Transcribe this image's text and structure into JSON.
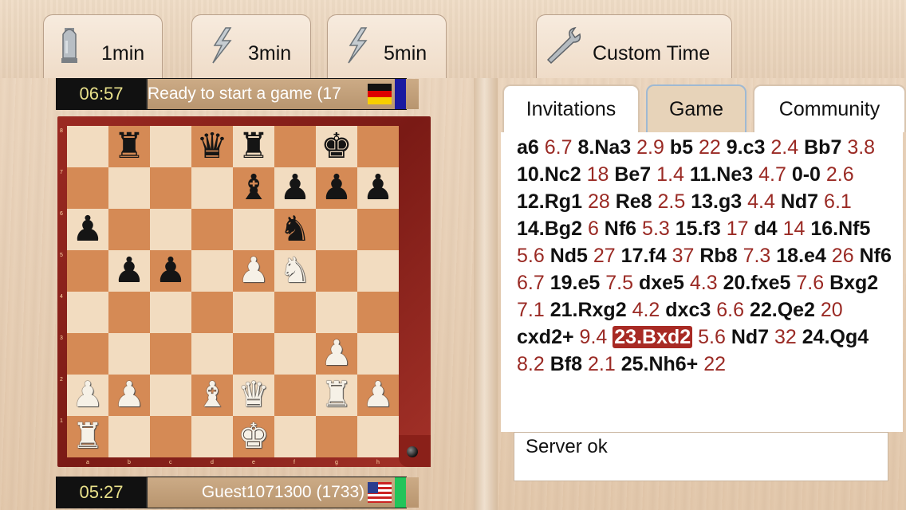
{
  "time_controls": [
    {
      "label": "1min",
      "icon": "bullet-icon"
    },
    {
      "label": "3min",
      "icon": "lightning-icon"
    },
    {
      "label": "5min",
      "icon": "lightning-icon"
    },
    {
      "label": "Custom Time",
      "icon": "wrench-icon"
    }
  ],
  "opponent": {
    "clock": "06:57",
    "name": "Ready to start a game (17",
    "flag": "germany-flag-icon"
  },
  "player": {
    "clock": "05:27",
    "name": "Guest1071300 (1733)",
    "flag": "usa-flag-icon"
  },
  "colors": {
    "accent": "#a82a24",
    "time_text": "#9a2a24",
    "turn_active": "#22c45a",
    "turn_inactive": "#1a1aa0"
  },
  "board": {
    "ranks": [
      "8",
      "7",
      "6",
      "5",
      "4",
      "3",
      "2",
      "1"
    ],
    "files": [
      "a",
      "b",
      "c",
      "d",
      "e",
      "f",
      "g",
      "h"
    ],
    "position": [
      [
        "",
        "bR",
        "",
        "bQ",
        "bR",
        "",
        "bK",
        ""
      ],
      [
        "",
        "",
        "",
        "",
        "bB",
        "bP",
        "bP",
        "bP"
      ],
      [
        "bP",
        "",
        "",
        "",
        "",
        "bN",
        "",
        ""
      ],
      [
        "",
        "bP",
        "bP",
        "",
        "wP",
        "wN",
        "",
        ""
      ],
      [
        "",
        "",
        "",
        "",
        "",
        "",
        "",
        ""
      ],
      [
        "",
        "",
        "",
        "",
        "",
        "",
        "wP",
        ""
      ],
      [
        "wP",
        "wP",
        "",
        "wB",
        "wQ",
        "",
        "wR",
        "wP"
      ],
      [
        "wR",
        "",
        "",
        "",
        "wK",
        "",
        "",
        ""
      ]
    ]
  },
  "tabs": [
    {
      "label": "Invitations",
      "active": false
    },
    {
      "label": "Game",
      "active": true
    },
    {
      "label": "Community",
      "active": false
    }
  ],
  "moves": [
    {
      "m": "a6",
      "t": "6.7"
    },
    {
      "m": "8.Na3",
      "t": "2.9"
    },
    {
      "m": "b5",
      "t": "22"
    },
    {
      "m": "9.c3",
      "t": "2.4"
    },
    {
      "m": "Bb7",
      "t": "3.8"
    },
    {
      "m": "10.Nc2",
      "t": "18"
    },
    {
      "m": "Be7",
      "t": "1.4"
    },
    {
      "m": "11.Ne3",
      "t": "4.7"
    },
    {
      "m": "0-0",
      "t": "2.6"
    },
    {
      "m": "12.Rg1",
      "t": "28"
    },
    {
      "m": "Re8",
      "t": "2.5"
    },
    {
      "m": "13.g3",
      "t": "4.4"
    },
    {
      "m": "Nd7",
      "t": "6.1"
    },
    {
      "m": "14.Bg2",
      "t": "6"
    },
    {
      "m": "Nf6",
      "t": "5.3"
    },
    {
      "m": "15.f3",
      "t": "17"
    },
    {
      "m": "d4",
      "t": "14"
    },
    {
      "m": "16.Nf5",
      "t": "5.6"
    },
    {
      "m": "Nd5",
      "t": "27"
    },
    {
      "m": "17.f4",
      "t": "37"
    },
    {
      "m": "Rb8",
      "t": ""
    },
    {
      "m": "",
      "t": "7.3"
    },
    {
      "m": "18.e4",
      "t": "26"
    },
    {
      "m": "Nf6",
      "t": "6.7"
    },
    {
      "m": "19.e5",
      "t": "7.5"
    },
    {
      "m": "dxe5",
      "t": "4.3"
    },
    {
      "m": "20.fxe5",
      "t": "7.6"
    },
    {
      "m": "Bxg2",
      "t": "7.1"
    },
    {
      "m": "21.Rxg2",
      "t": "4.2"
    },
    {
      "m": "dxc3",
      "t": "6.6"
    },
    {
      "m": "22.Qe2",
      "t": "20"
    },
    {
      "m": "cxd2+",
      "t": "9.4"
    },
    {
      "m": "23.Bxd2",
      "t": "5.6",
      "hl": true
    },
    {
      "m": "Nd7",
      "t": "32"
    },
    {
      "m": "24.Qg4",
      "t": "8.2"
    },
    {
      "m": "Bf8",
      "t": "2.1"
    },
    {
      "m": "25.Nh6+",
      "t": "22"
    }
  ],
  "status": "Server ok"
}
